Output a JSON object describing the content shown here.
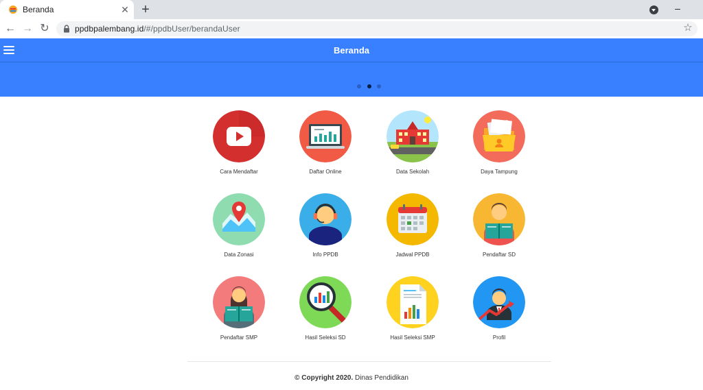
{
  "browser": {
    "tab_title": "Beranda",
    "tab_close": "✕",
    "new_tab": "+",
    "url_host": "ppdbpalembang.id",
    "url_path": "/#/ppdbUser/berandaUser",
    "back": "←",
    "forward": "→",
    "reload": "↻",
    "minimize": "–"
  },
  "header": {
    "title": "Beranda",
    "color": "#3880ff"
  },
  "slider": {
    "dot_count": 3,
    "active_index": 1
  },
  "menu": [
    {
      "label": "Cara Mendaftar",
      "icon": "youtube-play-icon",
      "color": "#d32f2f"
    },
    {
      "label": "Daftar Online",
      "icon": "laptop-chart-icon",
      "color": "#f15a45"
    },
    {
      "label": "Data Sekolah",
      "icon": "school-building-icon",
      "color": "#4fc3f7"
    },
    {
      "label": "Daya Tampung",
      "icon": "folder-profile-icon",
      "color": "#f26b5b"
    },
    {
      "label": "Data Zonasi",
      "icon": "map-pin-icon",
      "color": "#8fdcb1"
    },
    {
      "label": "Info PPDB",
      "icon": "call-center-icon",
      "color": "#3aaee8"
    },
    {
      "label": "Jadwal PPDB",
      "icon": "calendar-icon",
      "color": "#f5b800"
    },
    {
      "label": "Pendaftar SD",
      "icon": "boy-reading-icon",
      "color": "#f7b733"
    },
    {
      "label": "Pendaftar SMP",
      "icon": "girl-reading-icon",
      "color": "#f47b7b"
    },
    {
      "label": "Hasil Seleksi SD",
      "icon": "magnifier-chart-icon",
      "color": "#7ed957"
    },
    {
      "label": "Hasil Seleksi SMP",
      "icon": "document-chart-icon",
      "color": "#ffd21f"
    },
    {
      "label": "Profil",
      "icon": "businessman-growth-icon",
      "color": "#2196f3"
    }
  ],
  "footer": {
    "copyright": "© Copyright 2020.",
    "org": " Dinas Pendidikan"
  }
}
